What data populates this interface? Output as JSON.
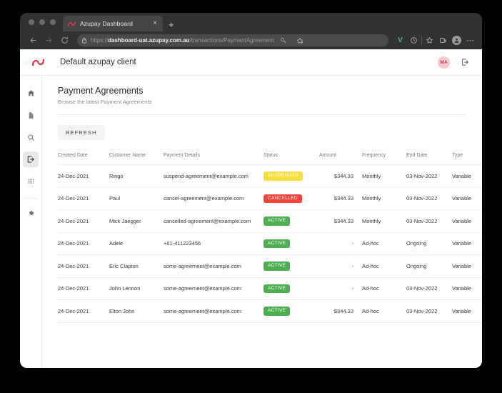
{
  "browser": {
    "tab": {
      "title": "Azupay Dashboard",
      "favicon": "azupay-logo-icon",
      "close_label": "×"
    },
    "new_tab_label": "+",
    "nav": {
      "back": "←",
      "forward": "→",
      "reload": "⟳"
    },
    "url": {
      "scheme": "https://",
      "host": "dashboard-uat.azupay.com.au",
      "path": "/transactions/PaymentAgreement"
    },
    "toolbar_icons": [
      "key-icon",
      "add-to-collection-icon",
      "vue-devtools-icon",
      "history-circle-icon",
      "favorite-star-icon",
      "collections-icon",
      "profile-avatar-icon",
      "more-menu-icon"
    ],
    "extension_letter": "V",
    "more_label": "⋯"
  },
  "app": {
    "brand": "azupay-logo-icon",
    "client_name": "Default azupay client",
    "avatar_initials": "MA",
    "avatar_bg": "#f8c8cd",
    "logout_icon": "logout-icon"
  },
  "sidebar": {
    "items": [
      {
        "id": "home",
        "icon": "home-icon",
        "active": false
      },
      {
        "id": "documents",
        "icon": "document-icon",
        "active": false
      },
      {
        "id": "search",
        "icon": "search-icon",
        "active": false
      },
      {
        "id": "transactions",
        "icon": "transaction-export-icon",
        "active": true
      },
      {
        "id": "apps",
        "icon": "grid-apps-icon",
        "active": false
      }
    ],
    "footer": {
      "id": "settings",
      "icon": "gear-icon",
      "active": false
    }
  },
  "main": {
    "title": "Payment Agreements",
    "subtitle": "Browse the latest Payment Agreements",
    "refresh_label": "REFRESH",
    "table": {
      "columns": [
        "Created Date",
        "Customer Name",
        "Payment Details",
        "Status",
        "Amount",
        "Frequency",
        "End Date",
        "Type"
      ],
      "rows": [
        {
          "created": "24-Dec-2021",
          "customer": "Ringo",
          "details": "suspend-agreement@example.com",
          "status": "SUSPENDED",
          "amount": "$344.33",
          "frequency": "Monthly",
          "end_date": "03-Nov-2022",
          "type": "Variable"
        },
        {
          "created": "24-Dec-2021",
          "customer": "Paul",
          "details": "cancel-agreement@example.com",
          "status": "CANCELLED",
          "amount": "$344.33",
          "frequency": "Monthly",
          "end_date": "03-Nov-2022",
          "type": "Variable"
        },
        {
          "created": "24-Dec-2021",
          "customer": "Mick Jaegger",
          "details": "cancelled-agreement@example.com",
          "status": "ACTIVE",
          "amount": "$344.33",
          "frequency": "Monthly",
          "end_date": "03-Nov-2022",
          "type": "Variable"
        },
        {
          "created": "24-Dec-2021",
          "customer": "Adele",
          "details": "+61-411223456",
          "status": "ACTIVE",
          "amount": "-",
          "frequency": "Ad-hoc",
          "end_date": "Ongoing",
          "type": "Variable"
        },
        {
          "created": "24-Dec-2021",
          "customer": "Eric Clapton",
          "details": "some-agreement@example.com",
          "status": "ACTIVE",
          "amount": "-",
          "frequency": "Ad-hoc",
          "end_date": "Ongoing",
          "type": "Variable"
        },
        {
          "created": "24-Dec-2021",
          "customer": "John Lennon",
          "details": "some-agreement@example.com",
          "status": "ACTIVE",
          "amount": "-",
          "frequency": "Ad-hoc",
          "end_date": "03-Nov-2022",
          "type": "Variable"
        },
        {
          "created": "24-Dec-2021",
          "customer": "Elton John",
          "details": "some-agreement@example.com",
          "status": "ACTIVE",
          "amount": "$344.33",
          "frequency": "Ad-hoc",
          "end_date": "03-Nov-2022",
          "type": "Variable"
        }
      ]
    }
  },
  "colors": {
    "status_suspended": "#f7e03d",
    "status_cancelled": "#f4453c",
    "status_active": "#4caf50",
    "brand_red": "#e8384f",
    "accent_text": "#3a3a3a"
  }
}
